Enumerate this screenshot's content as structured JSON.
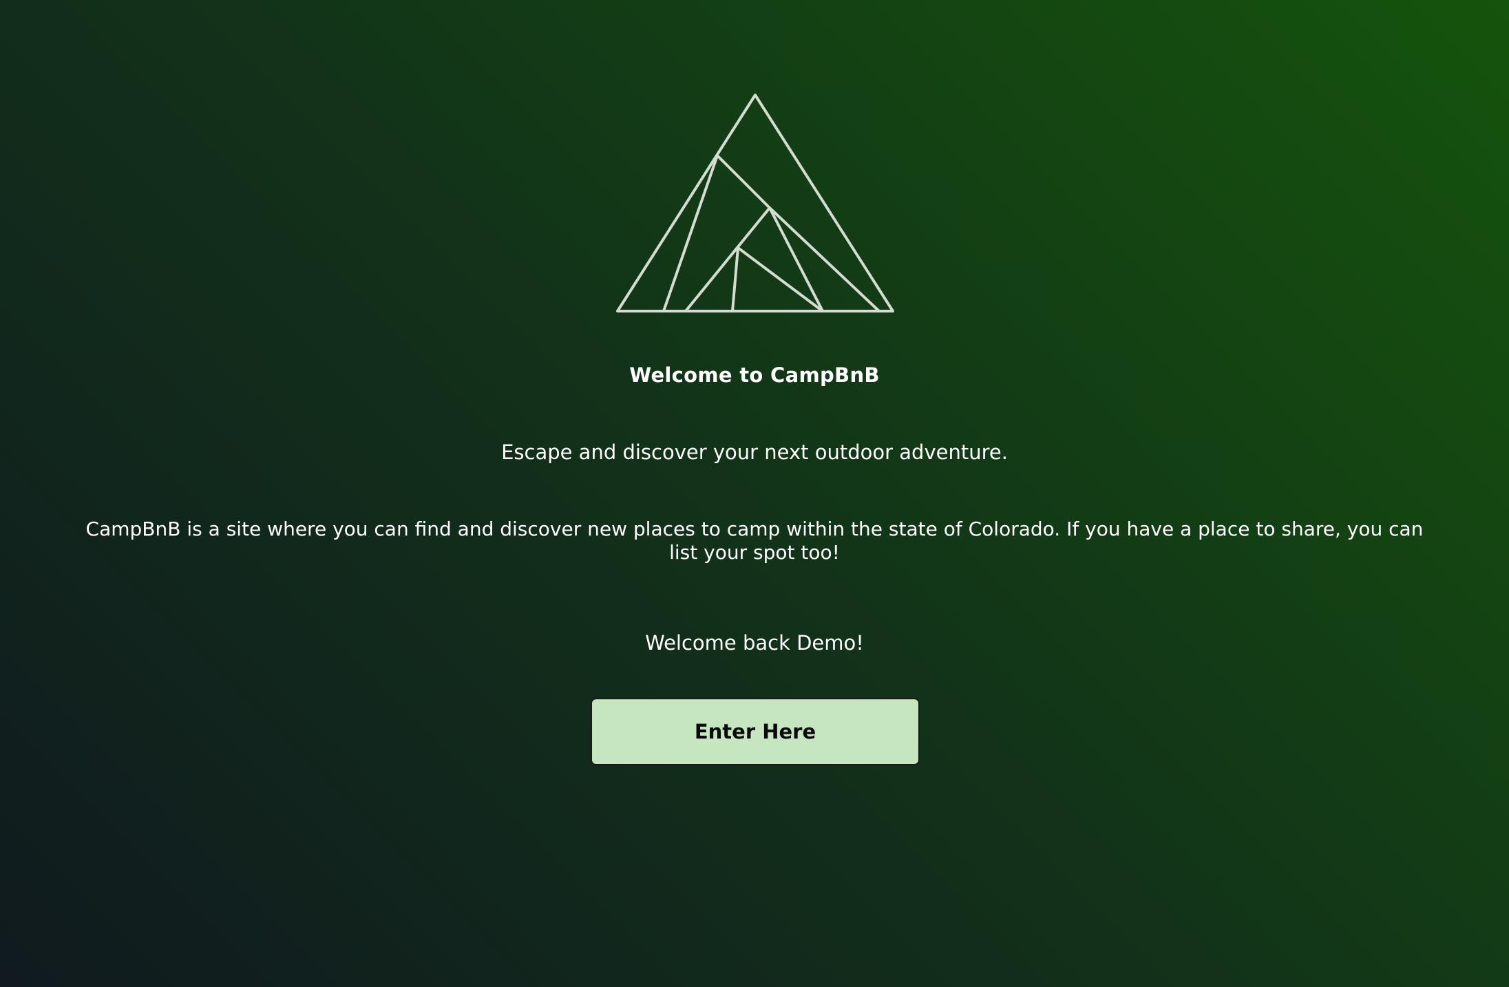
{
  "logo": {
    "icon": "mountain-logo-icon",
    "stroke_color": "#d4ddd0"
  },
  "welcome": {
    "title": "Welcome to CampBnB",
    "tagline": "Escape and discover your next outdoor adventure.",
    "description": "CampBnB is a site where you can find and discover new places to camp within the state of Colorado. If you have a place to share, you can list your spot too!",
    "greeting": "Welcome back Demo!"
  },
  "actions": {
    "enter_label": "Enter Here",
    "enter_bg": "#c6e6c0"
  },
  "theme": {
    "gradient_dark": "#101a1f",
    "gradient_green": "#15540c"
  }
}
